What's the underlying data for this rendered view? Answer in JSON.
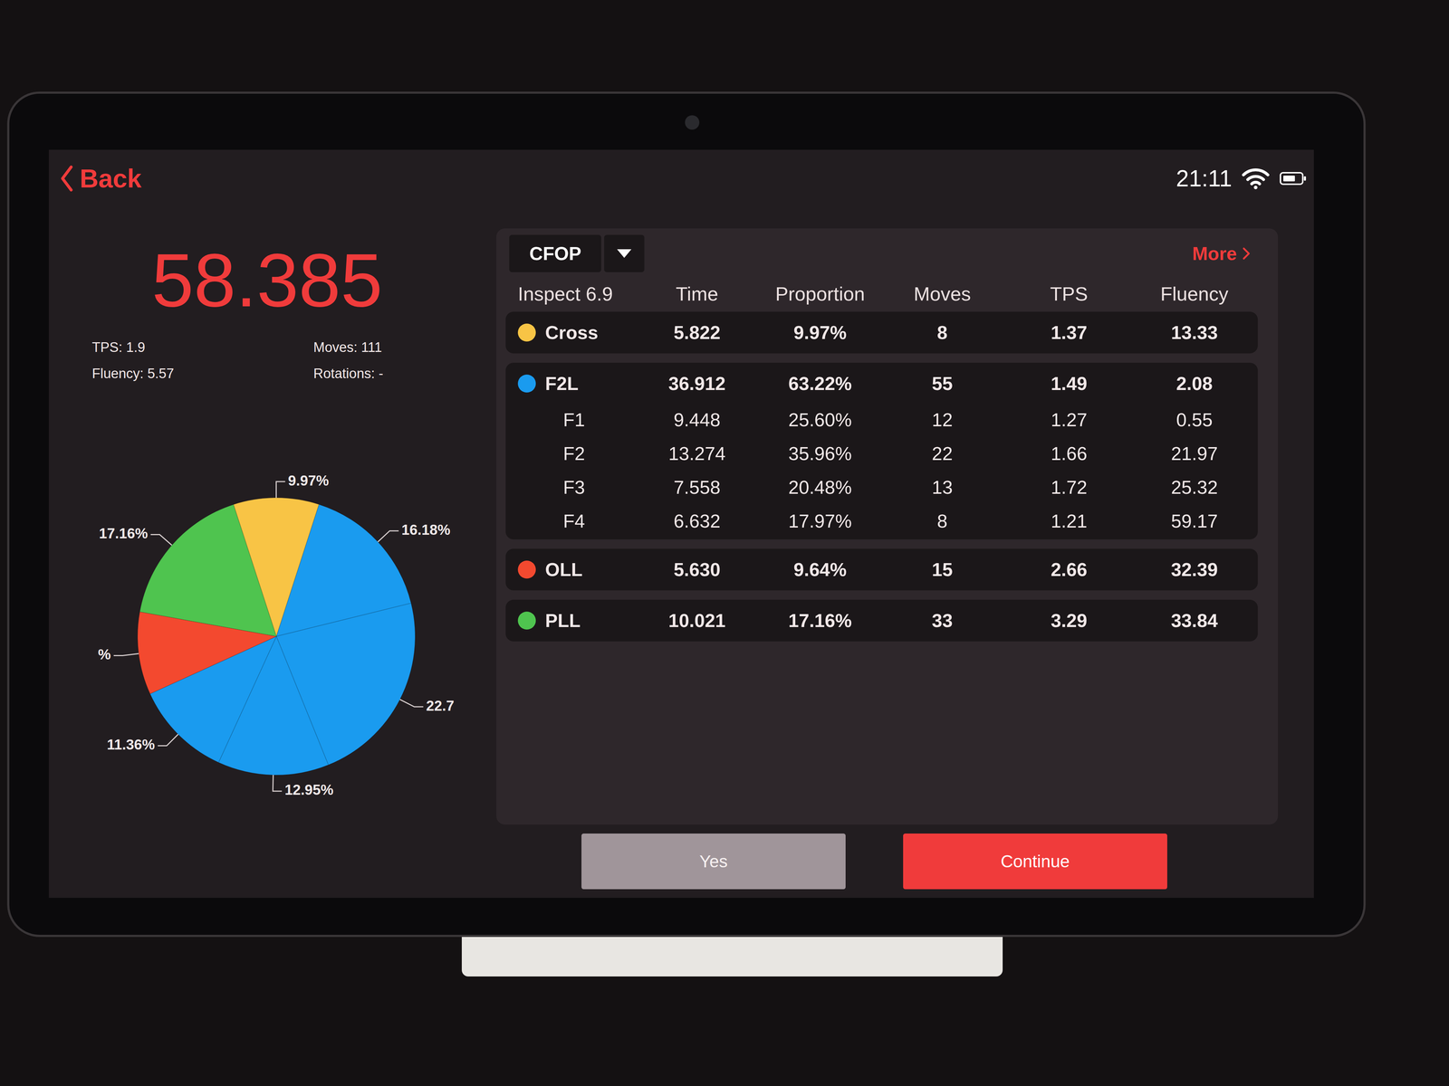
{
  "status_bar": {
    "back": "Back",
    "time": "21:11",
    "battery_level": 0.7
  },
  "summary": {
    "total": "58.385",
    "stats": [
      "TPS: 1.9",
      "Moves: 111",
      "Fluency: 5.57",
      "Rotations: -"
    ]
  },
  "pie": {
    "slices": [
      {
        "label": "9.97%",
        "value": 9.97,
        "color": "#f8c445"
      },
      {
        "label": "16.18%",
        "value": 16.18,
        "color": "#1a9bef"
      },
      {
        "label": "22.7",
        "value": 22.73,
        "color": "#1a9bef"
      },
      {
        "label": "12.95%",
        "value": 12.95,
        "color": "#1a9bef"
      },
      {
        "label": "11.36%",
        "value": 11.36,
        "color": "#1a9bef"
      },
      {
        "label": "%",
        "value": 9.64,
        "color": "#f3492f"
      },
      {
        "label": "17.16%",
        "value": 17.16,
        "color": "#4fc44f"
      }
    ]
  },
  "table": {
    "method": "CFOP",
    "more": "More",
    "inspect": "Inspect 6.9",
    "columns": [
      "Time",
      "Proportion",
      "Moves",
      "TPS",
      "Fluency"
    ],
    "groups": [
      {
        "color": "#f8c445",
        "rows": [
          {
            "kind": "main",
            "name": "Cross",
            "cells": [
              "5.822",
              "9.97%",
              "8",
              "1.37",
              "13.33"
            ]
          }
        ]
      },
      {
        "color": "#1a9bef",
        "rows": [
          {
            "kind": "main",
            "name": "F2L",
            "cells": [
              "36.912",
              "63.22%",
              "55",
              "1.49",
              "2.08"
            ]
          },
          {
            "kind": "sub",
            "name": "F1",
            "cells": [
              "9.448",
              "25.60%",
              "12",
              "1.27",
              "0.55"
            ]
          },
          {
            "kind": "sub",
            "name": "F2",
            "cells": [
              "13.274",
              "35.96%",
              "22",
              "1.66",
              "21.97"
            ]
          },
          {
            "kind": "sub",
            "name": "F3",
            "cells": [
              "7.558",
              "20.48%",
              "13",
              "1.72",
              "25.32"
            ]
          },
          {
            "kind": "sub",
            "name": "F4",
            "cells": [
              "6.632",
              "17.97%",
              "8",
              "1.21",
              "59.17"
            ]
          }
        ]
      },
      {
        "color": "#f3492f",
        "rows": [
          {
            "kind": "main",
            "name": "OLL",
            "cells": [
              "5.630",
              "9.64%",
              "15",
              "2.66",
              "32.39"
            ]
          }
        ]
      },
      {
        "color": "#4fc44f",
        "rows": [
          {
            "kind": "main",
            "name": "PLL",
            "cells": [
              "10.021",
              "17.16%",
              "33",
              "3.29",
              "33.84"
            ]
          }
        ]
      }
    ]
  },
  "buttons": [
    {
      "label": "Yes",
      "kind": "secondary"
    },
    {
      "label": "Continue",
      "kind": "primary"
    }
  ]
}
